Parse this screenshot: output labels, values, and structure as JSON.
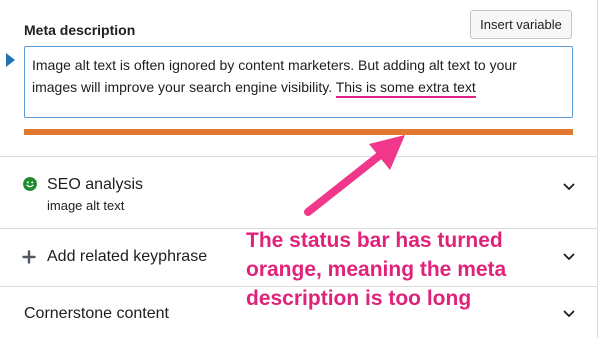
{
  "meta_description": {
    "label": "Meta description",
    "insert_button_label": "Insert variable",
    "text_main": "Image alt text is often ignored by content marketers. But adding alt text to your images will improve your search engine visibility. ",
    "text_extra": "This is some extra text",
    "length_status_color": "#e27730"
  },
  "panels": [
    {
      "title": "SEO analysis",
      "subtitle": "image alt text",
      "icon": "smiley-icon",
      "icon_color": "#1e8a2e"
    },
    {
      "title": "Add related keyphrase",
      "icon": "plus-icon"
    },
    {
      "title": "Cornerstone content"
    }
  ],
  "annotation": {
    "text": "The status bar has turned\norange, meaning the meta\ndescription is too long",
    "color": "#e0237a"
  }
}
